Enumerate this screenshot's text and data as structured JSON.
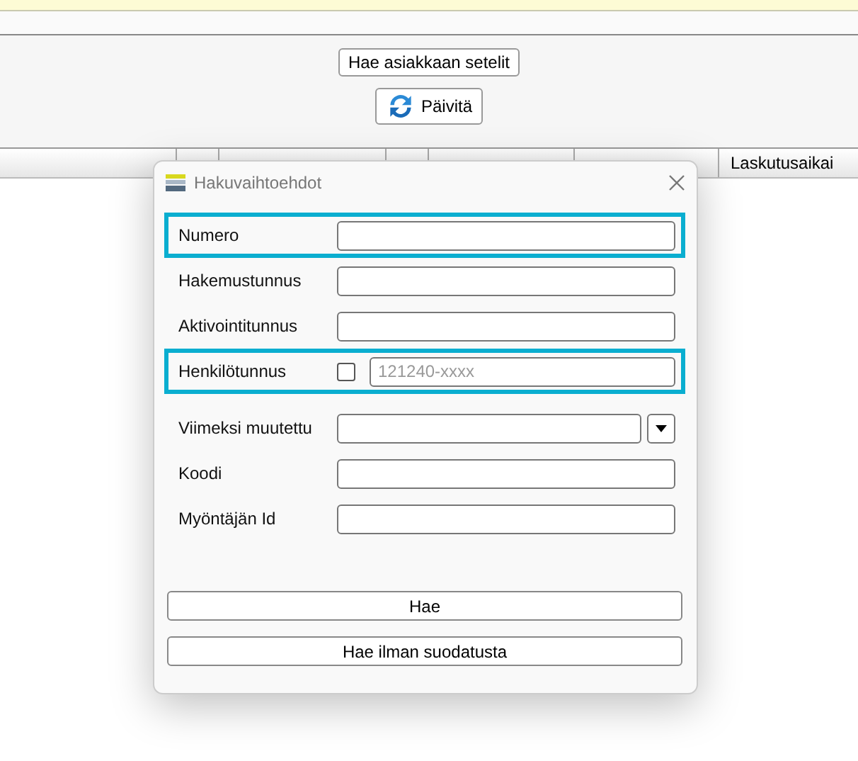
{
  "toolbar": {
    "buttons": [
      {
        "label": "Hae asiakkaan setelit",
        "kind": "plain"
      },
      {
        "label": "Päivitä",
        "kind": "refresh"
      }
    ]
  },
  "table": {
    "columns": [
      {},
      {},
      {},
      {},
      {},
      {},
      {
        "label": "Laskutusaikai"
      }
    ]
  },
  "dialog": {
    "title": "Hakuvaihtoehdot",
    "fields": [
      {
        "label": "Numero",
        "kind": "text",
        "highlighted": true
      },
      {
        "label": "Hakemustunnus",
        "kind": "text",
        "highlighted": false
      },
      {
        "label": "Aktivointitunnus",
        "kind": "text",
        "highlighted": false
      },
      {
        "label": "Henkilötunnus",
        "kind": "checked-text",
        "highlighted": true,
        "checked": false,
        "placeholder": "121240-xxxx"
      },
      {
        "label": "Viimeksi muutettu",
        "kind": "dropdown",
        "highlighted": false
      },
      {
        "label": "Koodi",
        "kind": "text",
        "highlighted": false
      },
      {
        "label": "Myöntäjän Id",
        "kind": "text",
        "highlighted": false
      }
    ],
    "buttons": [
      "Hae",
      "Hae ilman suodatusta"
    ]
  }
}
